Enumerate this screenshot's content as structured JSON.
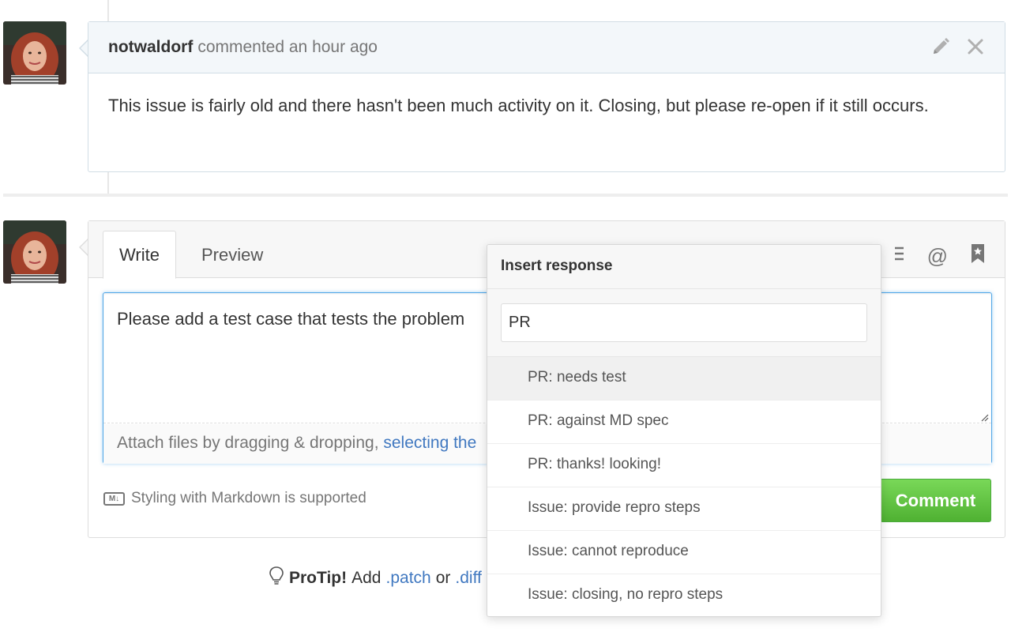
{
  "first_comment": {
    "author": "notwaldorf",
    "meta": "commented an hour ago",
    "body": "This issue is fairly old and there hasn't been much activity on it. Closing, but please re-open if it still occurs."
  },
  "new_comment": {
    "tabs": [
      "Write",
      "Preview"
    ],
    "textarea_value": "Please add a test case that tests the problem",
    "attach_text": "Attach files by dragging & dropping, ",
    "attach_link": "selecting the",
    "markdown_note": "Styling with Markdown is supported",
    "markdown_badge": "M↓",
    "comment_button": "Comment",
    "toolbar": {
      "mention_icon": "@",
      "saved_replies_icon": "bookmark-icon",
      "tasklist_icon": "tasklist-icon"
    }
  },
  "protip": {
    "bold": "ProTip!",
    "text": " Add ",
    "link1": ".patch",
    "middle": " or ",
    "link2": ".diff"
  },
  "dropdown": {
    "title": "Insert response",
    "filter_value": "PR",
    "items": [
      "PR: needs test",
      "PR: against MD spec",
      "PR: thanks! looking!",
      "Issue: provide repro steps",
      "Issue: cannot reproduce",
      "Issue: closing, no repro steps"
    ],
    "selected_index": 0
  },
  "colors": {
    "link": "#4078c0",
    "focus_border": "#51a7e8",
    "comment_button": "#55b634"
  }
}
